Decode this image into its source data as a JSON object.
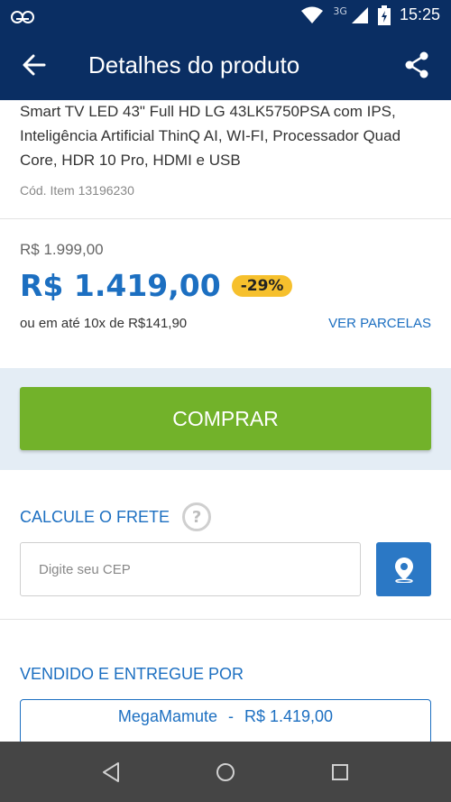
{
  "status_bar": {
    "network": "3G",
    "time": "15:25",
    "icons": [
      "voicemail-icon",
      "wifi-icon",
      "signal-icon",
      "battery-icon"
    ]
  },
  "app_bar": {
    "title": "Detalhes do produto",
    "icons": [
      "back-arrow-icon",
      "share-icon"
    ]
  },
  "product": {
    "title": "Smart TV LED 43\" Full HD LG 43LK5750PSA com IPS, Inteligência Artificial ThinQ AI, WI-FI, Processador Quad Core, HDR 10 Pro, HDMI e USB",
    "code": "Cód. Item 13196230"
  },
  "price": {
    "old": "R$ 1.999,00",
    "current": "R$ 1.419,00",
    "discount": "-29%",
    "installments": "ou em até 10x de R$141,90",
    "installments_link": "VER PARCELAS"
  },
  "buy": {
    "label": "COMPRAR",
    "color": "#72b22a"
  },
  "shipping": {
    "title": "CALCULE O FRETE",
    "help": "?",
    "cep_placeholder": "Digite seu CEP",
    "cep_value": ""
  },
  "seller": {
    "title": "VENDIDO E ENTREGUE POR",
    "name": "MegaMamute",
    "separator": "-",
    "price": "R$ 1.419,00"
  },
  "colors": {
    "header": "#0a2e63",
    "accent": "#1c6fc1",
    "badge": "#f6c02d"
  }
}
